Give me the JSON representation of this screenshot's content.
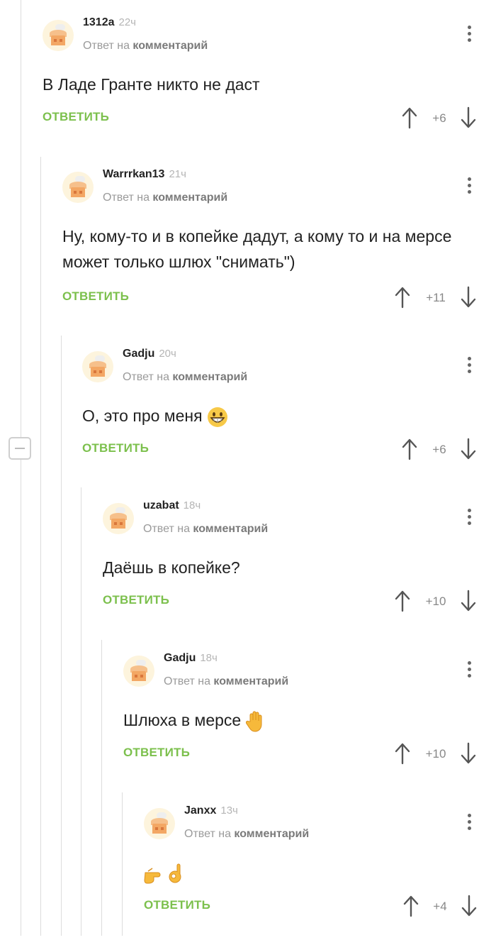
{
  "reply_label": "ОТВЕТИТЬ",
  "reply_meta_prefix": "Ответ на",
  "reply_meta_target": "комментарий",
  "comments": [
    {
      "user": "1312a",
      "time": "22ч",
      "text": "В Ладе Гранте никто не даст",
      "score": "+6"
    },
    {
      "user": "Warrrkan13",
      "time": "21ч",
      "text": "Ну, кому-то и в копейке дадут, а кому то и на мерсе может только шлюх \"снимать\")",
      "score": "+11"
    },
    {
      "user": "Gadju",
      "time": "20ч",
      "text": "О, это про меня",
      "emoji": "grinning-face-emoji",
      "score": "+6"
    },
    {
      "user": "uzabat",
      "time": "18ч",
      "text": "Даёшь в копейке?",
      "score": "+10"
    },
    {
      "user": "Gadju",
      "time": "18ч",
      "text": "Шлюха в мерсе",
      "emoji": "raised-hand-emoji",
      "score": "+10"
    },
    {
      "user": "Janxx",
      "time": "13ч",
      "text": "",
      "emoji": "pointing-hand-ok-hand-emoji",
      "score": "+4"
    }
  ],
  "colors": {
    "reply_green": "#7cc04d",
    "thread_line": "#dcdcdc",
    "muted_text": "#9a9a9a"
  },
  "icons": {
    "up": "arrow-up-icon",
    "down": "arrow-down-icon",
    "menu": "more-vertical-icon",
    "collapse": "collapse-minus-icon"
  }
}
